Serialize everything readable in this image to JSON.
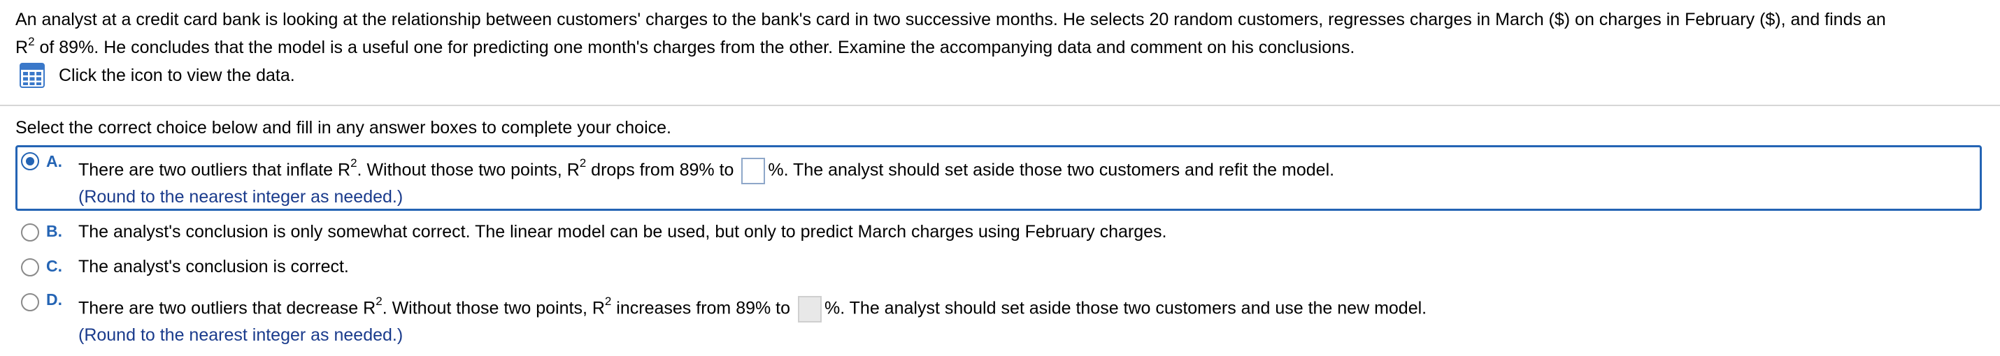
{
  "question": {
    "line1": "An analyst at a credit card bank is looking at the relationship between customers' charges to the bank's card in two successive months. He selects 20 random customers, regresses charges in March ($) on charges in February ($), and finds an",
    "line2_prefix": "R",
    "line2_sup": "2",
    "line2_rest": " of 89%. He concludes that the model is a useful one for predicting one month's charges from the other. Examine the accompanying data and comment on his conclusions."
  },
  "data_link": {
    "icon": "grid-icon",
    "label": "Click the icon to view the data."
  },
  "instruction": "Select the correct choice below and fill in any answer boxes to complete your choice.",
  "choices": {
    "a": {
      "letter": "A.",
      "selected": true,
      "text1": "There are two outliers that inflate R",
      "sup1": "2",
      "text2": ". Without those two points, R",
      "sup2": "2",
      "text3": " drops from 89% to ",
      "answer_value": "",
      "text4": "%. The analyst should set aside those two customers and refit the model.",
      "hint": "(Round to the nearest integer as needed.)"
    },
    "b": {
      "letter": "B.",
      "selected": false,
      "text": "The analyst's conclusion is only somewhat correct. The linear model can be used, but only to predict March charges using February charges."
    },
    "c": {
      "letter": "C.",
      "selected": false,
      "text": "The analyst's conclusion is correct."
    },
    "d": {
      "letter": "D.",
      "selected": false,
      "text1": "There are two outliers that decrease R",
      "sup1": "2",
      "text2": ". Without those two points, R",
      "sup2": "2",
      "text3": " increases from 89% to ",
      "answer_value": "",
      "text4": "%. The analyst should set aside those two customers and use the new model.",
      "hint": "(Round to the nearest integer as needed.)"
    }
  },
  "colors": {
    "accent": "#2464b4",
    "hint": "#1a3b8c"
  }
}
